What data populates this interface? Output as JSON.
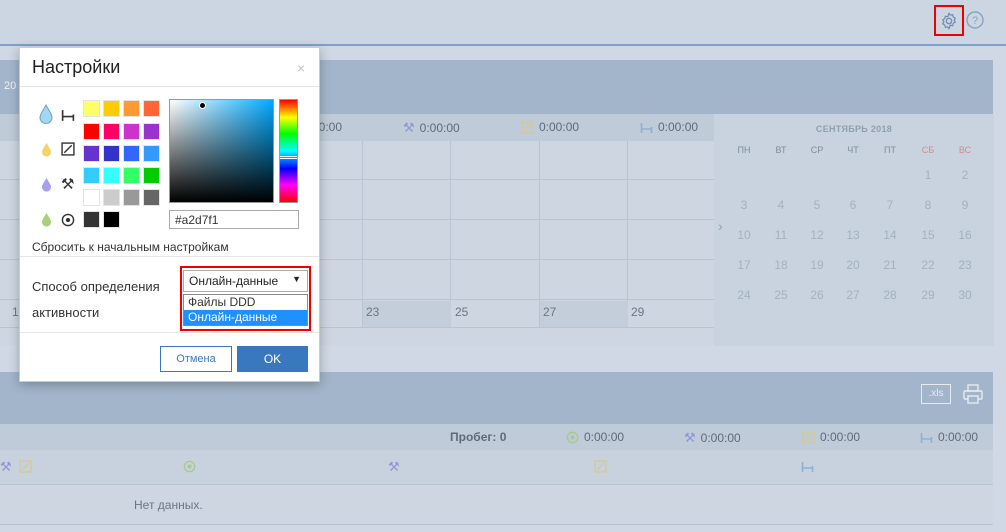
{
  "colors": {
    "accent": "#3a78bd",
    "highlight_outline": "#ee0000",
    "selected_option": "#1e90ff",
    "current_color": "#a2d7f1"
  },
  "header": {
    "icons": [
      "gear-icon",
      "help-icon"
    ]
  },
  "panel1": {
    "year_fragment": "20",
    "stats": [
      {
        "icon": "hammers-icon",
        "value": "0:00:00"
      },
      {
        "icon": "edit-box-icon",
        "value": "0:00:00"
      },
      {
        "icon": "bed-icon",
        "value": "0:00:00"
      }
    ],
    "stat_partial": "00:00",
    "day_numbers": [
      "1",
      "23",
      "25",
      "27",
      "29"
    ]
  },
  "calendar": {
    "title": "СЕНТЯБРЬ 2018",
    "weekdays": [
      "ПН",
      "ВТ",
      "СР",
      "ЧТ",
      "ПТ",
      "СБ",
      "ВС"
    ],
    "weeks": [
      [
        "",
        "",
        "",
        "",
        "",
        "1",
        "2"
      ],
      [
        "3",
        "4",
        "5",
        "6",
        "7",
        "8",
        "9"
      ],
      [
        "10",
        "11",
        "12",
        "13",
        "14",
        "15",
        "16"
      ],
      [
        "17",
        "18",
        "19",
        "20",
        "21",
        "22",
        "23"
      ],
      [
        "24",
        "25",
        "26",
        "27",
        "28",
        "29",
        "30"
      ]
    ]
  },
  "panel2": {
    "export_label": ".xls",
    "mileage_label": "Пробег: 0",
    "stats": [
      "0:00:00",
      "0:00:00",
      "0:00:00",
      "0:00:00"
    ],
    "empty_text": "Нет данных."
  },
  "modal": {
    "title": "Настройки",
    "close": "×",
    "categories": [
      {
        "drop": "drop-icon",
        "icon": "bed-icon"
      },
      {
        "drop": "drop-icon",
        "icon": "edit-box-icon"
      },
      {
        "drop": "drop-icon",
        "icon": "hammers-icon"
      },
      {
        "drop": "drop-icon",
        "icon": "target-icon"
      }
    ],
    "swatches": [
      [
        "#ffff66",
        "#ffcc00",
        "#ff9933",
        "#ff6633"
      ],
      [
        "#ff0000",
        "#ff0066",
        "#cc33cc",
        "#9933cc"
      ],
      [
        "#6633cc",
        "#3333cc",
        "#3366ff",
        "#3399ff"
      ],
      [
        "#33ccff",
        "#33ffff",
        "#33ff66",
        "#00cc00"
      ],
      [
        "#ffffff",
        "#cccccc",
        "#999999",
        "#666666"
      ],
      [
        "#333333",
        "#000000"
      ]
    ],
    "hex_value": "#a2d7f1",
    "reset_label": "Сбросить к начальным настройкам",
    "activity_label": "Способ определения активности",
    "select_value": "Онлайн-данные",
    "options": [
      "Файлы DDD",
      "Онлайн-данные"
    ],
    "selected_option_index": 1,
    "cancel_label": "Отмена",
    "ok_label": "OK"
  }
}
